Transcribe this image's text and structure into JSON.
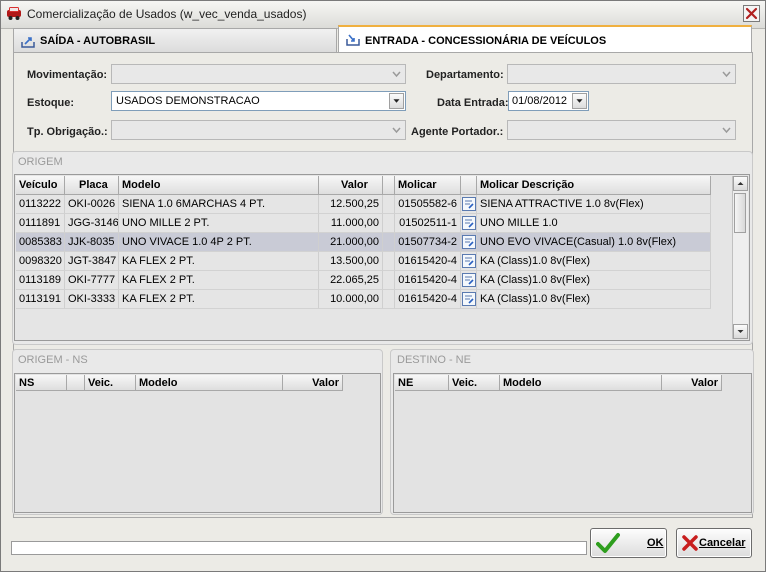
{
  "window": {
    "title": "Comercialização de Usados (w_vec_venda_usados)"
  },
  "tabs": [
    {
      "label": "SAÍDA - AUTOBRASIL"
    },
    {
      "label": "ENTRADA - CONCESSIONÁRIA DE VEÍCULOS"
    }
  ],
  "form": {
    "movimentacao_label": "Movimentação:",
    "movimentacao_value": "",
    "departamento_label": "Departamento:",
    "departamento_value": "",
    "estoque_label": "Estoque:",
    "estoque_value": "USADOS DEMONSTRACAO",
    "data_entrada_label": "Data Entrada:",
    "data_entrada_value": "01/08/2012",
    "tp_obrigacao_label": "Tp. Obrigação.:",
    "tp_obrigacao_value": "",
    "agente_portador_label": "Agente Portador.:",
    "agente_portador_value": ""
  },
  "origem": {
    "title": "ORIGEM",
    "columns": [
      "Veículo",
      "Placa",
      "Modelo",
      "Valor",
      "Molicar",
      "Molicar Descrição"
    ],
    "rows": [
      {
        "veiculo": "0113222",
        "placa": "OKI-0026",
        "modelo": "SIENA 1.0 6MARCHAS 4 PT.",
        "valor": "12.500,25",
        "molicar": "01505582-6",
        "descricao": "SIENA ATTRACTIVE 1.0 8v(Flex)"
      },
      {
        "veiculo": "0111891",
        "placa": "JGG-3146",
        "modelo": "UNO MILLE 2 PT.",
        "valor": "11.000,00",
        "molicar": "01502511-1",
        "descricao": "UNO MILLE 1.0"
      },
      {
        "veiculo": "0085383",
        "placa": "JJK-8035",
        "modelo": "UNO VIVACE 1.0 4P 2 PT.",
        "valor": "21.000,00",
        "molicar": "01507734-2",
        "descricao": "UNO EVO VIVACE(Casual) 1.0 8v(Flex)"
      },
      {
        "veiculo": "0098320",
        "placa": "JGT-3847",
        "modelo": "KA FLEX 2 PT.",
        "valor": "13.500,00",
        "molicar": "01615420-4",
        "descricao": "KA (Class)1.0 8v(Flex)"
      },
      {
        "veiculo": "0113189",
        "placa": "OKI-7777",
        "modelo": "KA FLEX 2 PT.",
        "valor": "22.065,25",
        "molicar": "01615420-4",
        "descricao": "KA (Class)1.0 8v(Flex)"
      },
      {
        "veiculo": "0113191",
        "placa": "OKI-3333",
        "modelo": "KA FLEX 2 PT.",
        "valor": "10.000,00",
        "molicar": "01615420-4",
        "descricao": "KA (Class)1.0 8v(Flex)"
      }
    ],
    "selected_row": 2
  },
  "origem_ns": {
    "title": "ORIGEM - NS",
    "columns": [
      "NS",
      "",
      "Veic.",
      "Modelo",
      "Valor"
    ]
  },
  "destino_ne": {
    "title": "DESTINO - NE",
    "columns": [
      "NE",
      "Veic.",
      "Modelo",
      "Valor"
    ]
  },
  "buttons": {
    "ok_label": "OK",
    "cancel_label": "Cancelar"
  },
  "icons": {
    "app": "car-icon",
    "tab_saida": "export-icon",
    "tab_entrada": "import-icon",
    "molicar_lookup": "lookup-icon",
    "ok": "checkmark-icon",
    "cancel": "x-icon"
  },
  "colors": {
    "tab_accent": "#f0b040",
    "selected_row": "#c9cbd6",
    "ok_check": "#2e9e1e",
    "cancel_x": "#c81e1e"
  }
}
